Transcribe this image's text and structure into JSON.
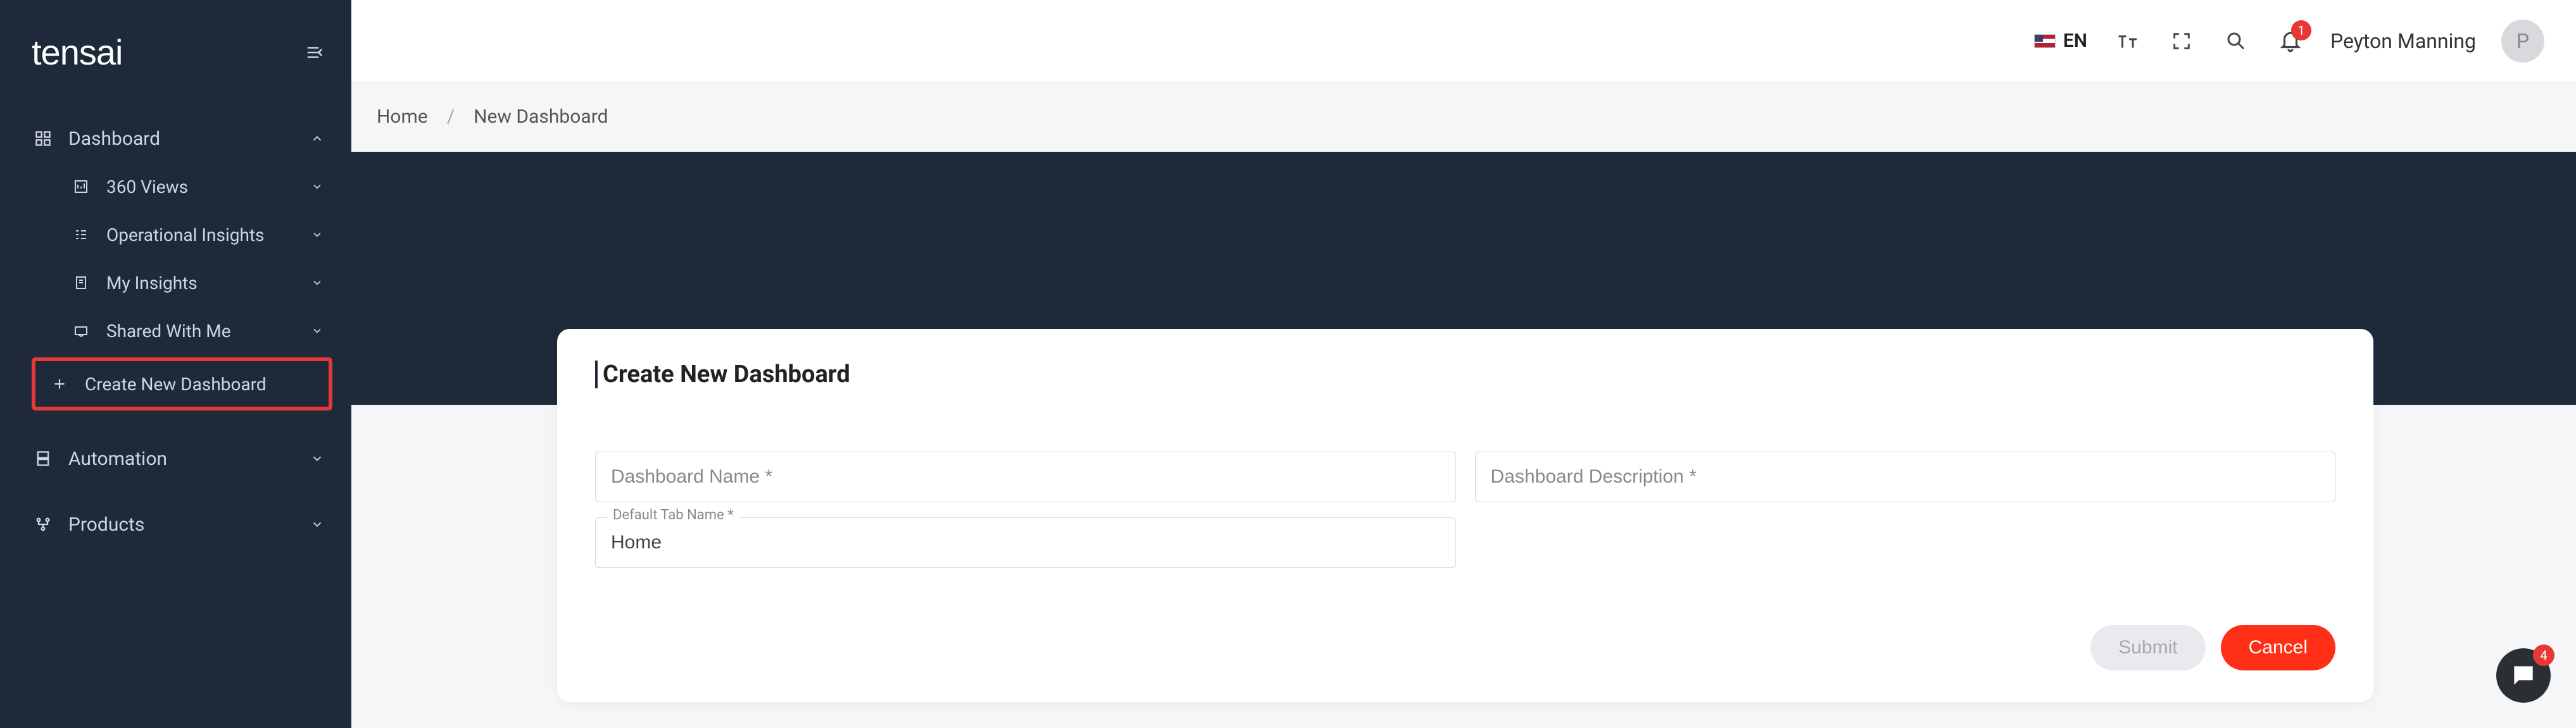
{
  "brand": {
    "name": "tensai"
  },
  "header": {
    "lang_code": "EN",
    "notif_count": "1",
    "username": "Peyton Manning",
    "avatar_initial": "P"
  },
  "breadcrumb": {
    "home": "Home",
    "sep": "/",
    "current": "New Dashboard"
  },
  "sidebar": {
    "dashboard": "Dashboard",
    "views": "360 Views",
    "operational": "Operational Insights",
    "myinsights": "My Insights",
    "shared": "Shared With Me",
    "create": "Create New Dashboard",
    "automation": "Automation",
    "products": "Products"
  },
  "card": {
    "title": "Create New Dashboard",
    "fields": {
      "name_ph": "Dashboard Name *",
      "desc_ph": "Dashboard Description *",
      "tab_label": "Default Tab Name *",
      "tab_value": "Home"
    },
    "buttons": {
      "submit": "Submit",
      "cancel": "Cancel"
    }
  },
  "chat": {
    "count": "4"
  }
}
